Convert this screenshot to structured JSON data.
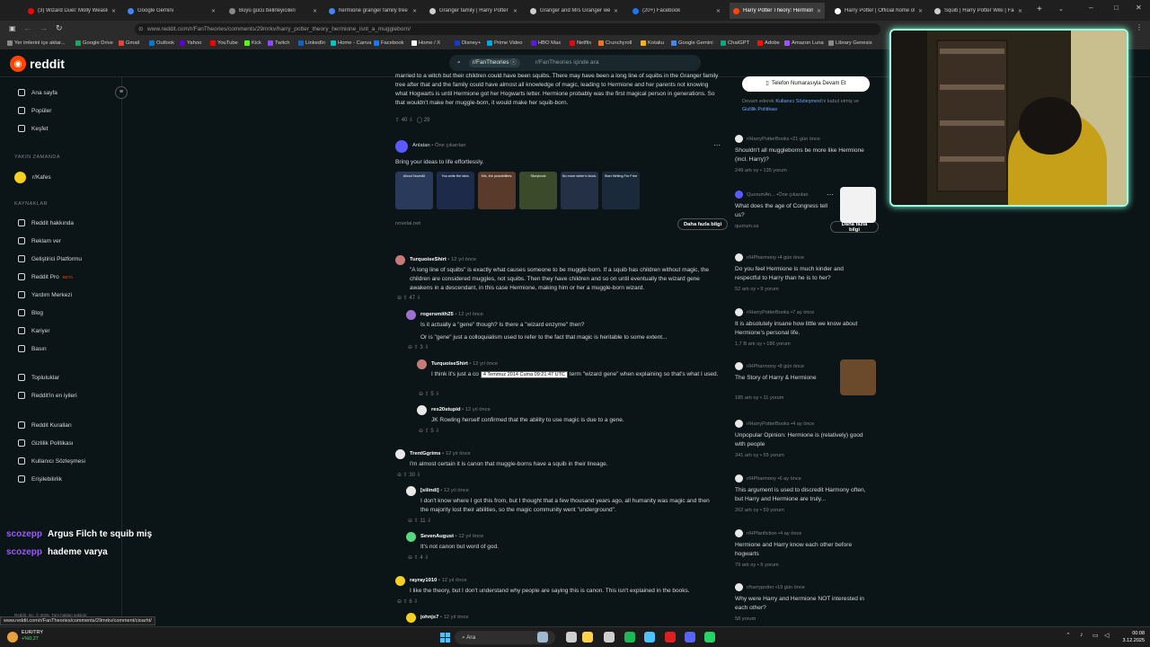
{
  "tabs": [
    {
      "title": "(3) Wizard Duel: Molly Weasley",
      "color": "#ff0000"
    },
    {
      "title": "Google Gemini",
      "color": "#4285f4"
    },
    {
      "title": "Büyü gücü belirleyicileri",
      "color": "#888888"
    },
    {
      "title": "hermione granger family tree -",
      "color": "#4285f4"
    },
    {
      "title": "Granger family | Harry Potter W",
      "color": "#cccccc"
    },
    {
      "title": "Granger and Mrs Granger were",
      "color": "#cccccc"
    },
    {
      "title": "(20+) Facebook",
      "color": "#1877f2"
    },
    {
      "title": "Harry Potter Theory: Hermione",
      "color": "#ff4500"
    },
    {
      "title": "Harry Potter | Official home of",
      "color": "#ffffff"
    },
    {
      "title": "Squib | Harry Potter Wiki | Fand",
      "color": "#cccccc"
    }
  ],
  "url": "www.reddit.com/r/FanTheories/comments/29mrkv/harry_potter_theory_hermione_isnt_a_muggleborn/",
  "bookmarks": [
    "Yer imlerini içe aktar...",
    "Google Drive",
    "Gmail",
    "Outlook",
    "Yahoo",
    "YouTube",
    "Kick",
    "Twitch",
    "LinkedIn",
    "Home - Canva",
    "Facebook",
    "Home / X",
    "Disney+",
    "Prime Video",
    "HBO Max",
    "Netflix",
    "Crunchyroll",
    "Kotaku",
    "Google Gemini",
    "ChatGPT",
    "Adobe",
    "Amazon Luna",
    "Library Genesis"
  ],
  "reddit": {
    "logo": "reddit",
    "search_chip": "r/FanTheories",
    "search_placeholder": "r/FanTheories içinde ara"
  },
  "nav": {
    "main": [
      "Ana sayfa",
      "Popüler",
      "Keşfet"
    ],
    "recent_header": "YAKIN ZAMANDA",
    "recent": [
      "r/Kafes"
    ],
    "resources_header": "KAYNAKLAR",
    "resources": [
      "Reddit hakkında",
      "Reklam ver",
      "Geliştirici Platformu",
      "Reddit Pro",
      "Yardım Merkezi",
      "Blog",
      "Kariyer",
      "Basın"
    ],
    "beta": "BETA",
    "community": [
      "Topluluklar",
      "Reddit'in en iyileri"
    ],
    "legal": [
      "Reddit Kuralları",
      "Gizlilik Politikası",
      "Kullanıcı Sözleşmesi",
      "Erişilebilirlik"
    ],
    "footer": "Reddit, Inc. © 2025. Tüm hakları saklıdır."
  },
  "chat": [
    {
      "user": "scozepp",
      "msg": "Argus Filch te squib miş"
    },
    {
      "user": "scozepp",
      "msg": "hademe varya"
    }
  ],
  "top_post": {
    "text": "married to a witch but their children could have been squibs. There may have been a long line of squibs in the Granger family tree after that and the family could have almost all knowledge of magic, leading to Hermione and her parents not knowing what Hogwarts is until Hermione got her Hogwarts letter. Hermione probably was the first magical person in generations. So that wouldn't make her muggle-born, it would make her squib-born.",
    "votes": "40",
    "comments": "29"
  },
  "ad": {
    "name": "Anlatan",
    "promoted": "Öne çıkarılan",
    "text": "Bring your ideas to life effortlessly.",
    "domain": "novelai.net",
    "cta": "Daha fazla bilgi",
    "thumbs": [
      "About NovelAI",
      "You write the idea.",
      "Mix, the possibilities.",
      "Storybook",
      "No more writer's block.",
      "Start Writing For Free"
    ]
  },
  "comments": [
    {
      "user": "TurquoiseShirt",
      "age": "12 yıl önce",
      "text": "\"A long line of squibs\" is exactly what causes someone to be muggle-born. If a squib has children without magic, the children are considered muggles, not squibs. Then they have children and so on until eventually the wizard gene awakens in a descendant, in this case Hermione, making him or her a muggle-born wizard.",
      "votes": "47"
    },
    {
      "user": "rogersmith25",
      "age": "12 yıl önce",
      "text": "Is it actually a \"gene\" though? Is there a \"wizard enzyme\" then?",
      "text2": "Or is \"gene\" just a colloquialism used to refer to the fact that magic is heritable to some extent...",
      "votes": "3"
    },
    {
      "user": "TurquoiseShirt",
      "age": "12 yıl önce",
      "text": "I think it's just a co",
      "text_tail": "term \"wizard gene\" when explaining so that's what I used.",
      "tooltip": "4 Temmuz 2014 Cuma 09:21:47 UTC",
      "votes": "5"
    },
    {
      "user": "res20stupid",
      "age": "12 yıl önce",
      "text": "JK Rowling herself confirmed that the ability to use magic is due to a gene.",
      "votes": "5"
    },
    {
      "user": "TrentGgrims",
      "age": "12 yıl önce",
      "text": "I'm almost certain it is canon that muggle-borns have a squib in their lineage.",
      "votes": "30"
    },
    {
      "user": "[silindi]",
      "age": "12 yıl önce",
      "text": "I don't know where I got this from, but I thought that a few thousand years ago, all humanity was magic and then the majority lost their abilities, so the magic community went \"underground\".",
      "votes": "11"
    },
    {
      "user": "SevenAugust",
      "age": "12 yıl önce",
      "text": "It's not canon but word of god.",
      "votes": "4"
    },
    {
      "user": "rayray1010",
      "age": "12 yıl önce",
      "text": "I like the theory, but I don't understand why people are saying this is canon. This isn't explained in the books.",
      "votes": "6"
    },
    {
      "user": "johnjs7",
      "age": "12 yıl önce",
      "text": "",
      "votes": ""
    }
  ],
  "right": {
    "signup_btn": "Telefon Numarasıyla Devam Et",
    "terms_a": "Devam ederek",
    "terms_link1": "Kullanıcı Sözleşmesi",
    "terms_b": "'ni kabul etmiş ve",
    "terms_link2": "Gizlilik Politikası",
    "posts": [
      {
        "sub": "r/HarryPotterBooks",
        "age": "21 gün önce",
        "title": "Shouldn't all muggleborns be more like Hermione (incl. Harry)?",
        "up": "249 artı oy",
        "com": "135 yorum"
      },
      {
        "sub": "QuorumAn...",
        "age": "Öne çıkarılan",
        "title": "What does the age of Congress tell us?",
        "up": "quorum.us",
        "com": "Daha fazla bilgi",
        "ad": true
      },
      {
        "sub": "r/HPharmony",
        "age": "4 gün önce",
        "title": "Do you feel Hermione is much kinder and respectful to Harry than he is to her?",
        "up": "52 artı oy",
        "com": "9 yorum"
      },
      {
        "sub": "r/HarryPotterBooks",
        "age": "7 ay önce",
        "title": "It is absolutely insane how little we know about Hermione's personal life.",
        "up": "1,7 B artı oy",
        "com": "186 yorum"
      },
      {
        "sub": "r/HPharmony",
        "age": "8 gün önce",
        "title": "The Story of Harry & Hermione",
        "up": "185 artı oy",
        "com": "11 yorum"
      },
      {
        "sub": "r/HarryPotterBooks",
        "age": "4 ay önce",
        "title": "Unpopular Opinion: Hermione is (relatively) good with people",
        "up": "341 artı oy",
        "com": "55 yorum"
      },
      {
        "sub": "r/HPharmony",
        "age": "6 ay önce",
        "title": "This argument is used to discredit Harmony often, but Harry and Hermione are truly...",
        "up": "262 artı oy",
        "com": "59 yorum"
      },
      {
        "sub": "r/HPfanfiction",
        "age": "4 ay önce",
        "title": "Hermione and Harry know each other before hogwarts",
        "up": "79 artı oy",
        "com": "6 yorum"
      },
      {
        "sub": "r/harrypotter",
        "age": "19 gün önce",
        "title": "Why were Harry and Hermione NOT interested in each other?",
        "up": "58 yorum",
        "com": ""
      }
    ]
  },
  "status_url": "www.reddit.com/r/FanTheories/comments/29mrkv/comment/cioarht/",
  "taskbar": {
    "ticker": "EUR/TRY",
    "ticker_change": "+%0,27",
    "search": "Ara",
    "time": "00:08",
    "date": "3.12.2025"
  }
}
